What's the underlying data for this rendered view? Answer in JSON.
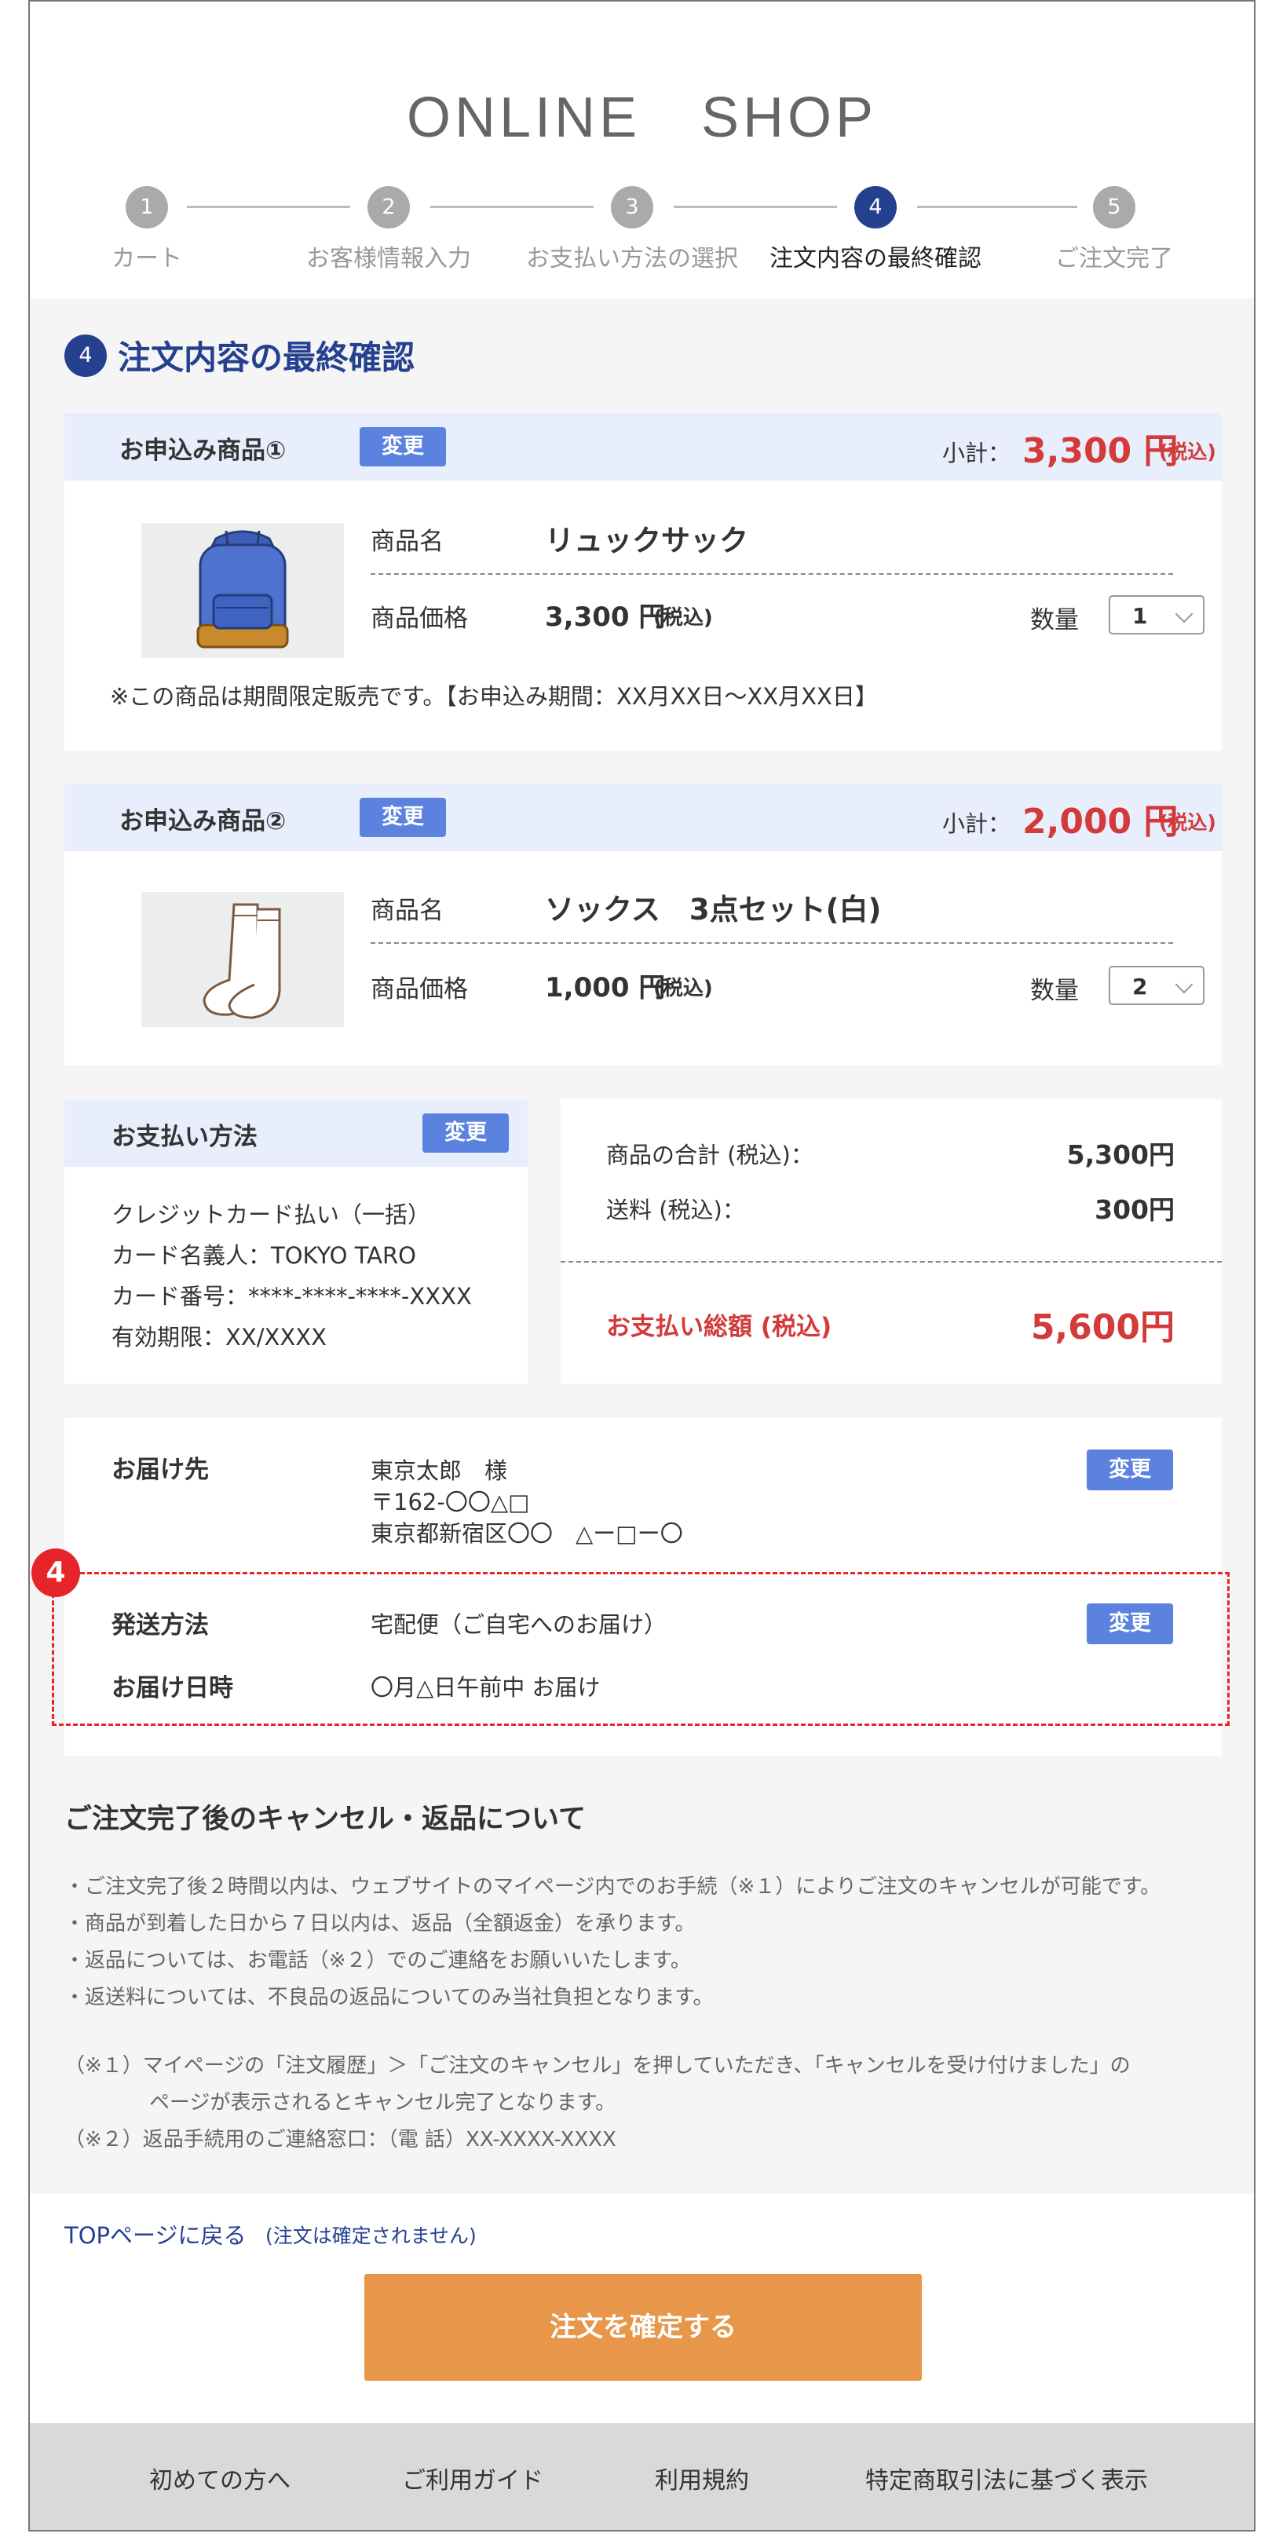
{
  "header": {
    "shop_title": "ONLINE　SHOP"
  },
  "steps": [
    {
      "num": "1",
      "label": "カート"
    },
    {
      "num": "2",
      "label": "お客様情報入力"
    },
    {
      "num": "3",
      "label": "お支払い方法の選択"
    },
    {
      "num": "4",
      "label": "注文内容の最終確認"
    },
    {
      "num": "5",
      "label": "ご注文完了"
    }
  ],
  "section": {
    "num": "4",
    "title": "注文内容の最終確認"
  },
  "items": [
    {
      "heading": "お申込み商品①",
      "change": "変更",
      "subtotal_label": "小計：",
      "subtotal_value": "3,300 円",
      "subtotal_tax": "(税込)",
      "name_label": "商品名",
      "name": "リュックサック",
      "price_label": "商品価格",
      "price": "3,300 円",
      "price_tax": "(税込)",
      "qty_label": "数量",
      "qty": "1",
      "note": "※この商品は期間限定販売です。【お申込み期間：XX月XX日〜XX月XX日】"
    },
    {
      "heading": "お申込み商品②",
      "change": "変更",
      "subtotal_label": "小計：",
      "subtotal_value": "2,000 円",
      "subtotal_tax": "(税込)",
      "name_label": "商品名",
      "name": "ソックス　3点セット(白)",
      "price_label": "商品価格",
      "price": "1,000 円",
      "price_tax": "(税込)",
      "qty_label": "数量",
      "qty": "2"
    }
  ],
  "payment": {
    "heading": "お支払い方法",
    "change": "変更",
    "lines": [
      "クレジットカード払い（一括）",
      "カード名義人：TOKYO TARO",
      "カード番号：****-****-****-XXXX",
      "有効期限：XX/XXXX"
    ]
  },
  "summary": {
    "goods_label": "商品の合計 (税込)：",
    "goods_value": "5,300円",
    "shipping_label": "送料 (税込)：",
    "shipping_value": "300円",
    "total_label": "お支払い総額 (税込)",
    "total_value": "5,600円"
  },
  "delivery": {
    "dest_label": "お届け先",
    "dest_lines": [
      "東京太郎　様",
      "〒162-〇〇△□",
      "東京都新宿区〇〇　△ー□ー〇"
    ],
    "change": "変更",
    "method_label": "発送方法",
    "method_value": "宅配便（ご自宅へのお届け）",
    "method_change": "変更",
    "datetime_label": "お届け日時",
    "datetime_value": "〇月△日午前中 お届け",
    "marker": "4"
  },
  "cancel": {
    "title": "ご注文完了後のキャンセル・返品について",
    "bullets": [
      "・ご注文完了後２時間以内は、ウェブサイトのマイページ内でのお手続（※１）によりご注文のキャンセルが可能です。",
      "・商品が到着した日から７日以内は、返品（全額返金）を承ります。",
      "・返品については、お電話（※２）でのご連絡をお願いいたします。",
      "・返送料については、不良品の返品についてのみ当社負担となります。"
    ],
    "notes": [
      "（※１）マイページの「注文履歴」＞「ご注文のキャンセル」を押していただき、「キャンセルを受け付けました」の",
      "ページが表示されるとキャンセル完了となります。",
      "（※２）返品手続用のご連絡窓口：（電 話）XX-XXXX-XXXX"
    ]
  },
  "back": {
    "link": "TOPページに戻る",
    "note": "(注文は確定されません)"
  },
  "confirm_button": "注文を確定する",
  "footer": [
    "初めての方へ",
    "ご利用ガイド",
    "利用規約",
    "特定商取引法に基づく表示"
  ],
  "colors": {
    "accent": "#25408f",
    "badge": "#5b82df",
    "price_red": "#d33a3a",
    "confirm": "#e7964a",
    "marker_red": "#e5252a"
  },
  "icons": {
    "item1": "backpack-image",
    "item2": "socks-image",
    "qty": "chevron-down-icon"
  }
}
